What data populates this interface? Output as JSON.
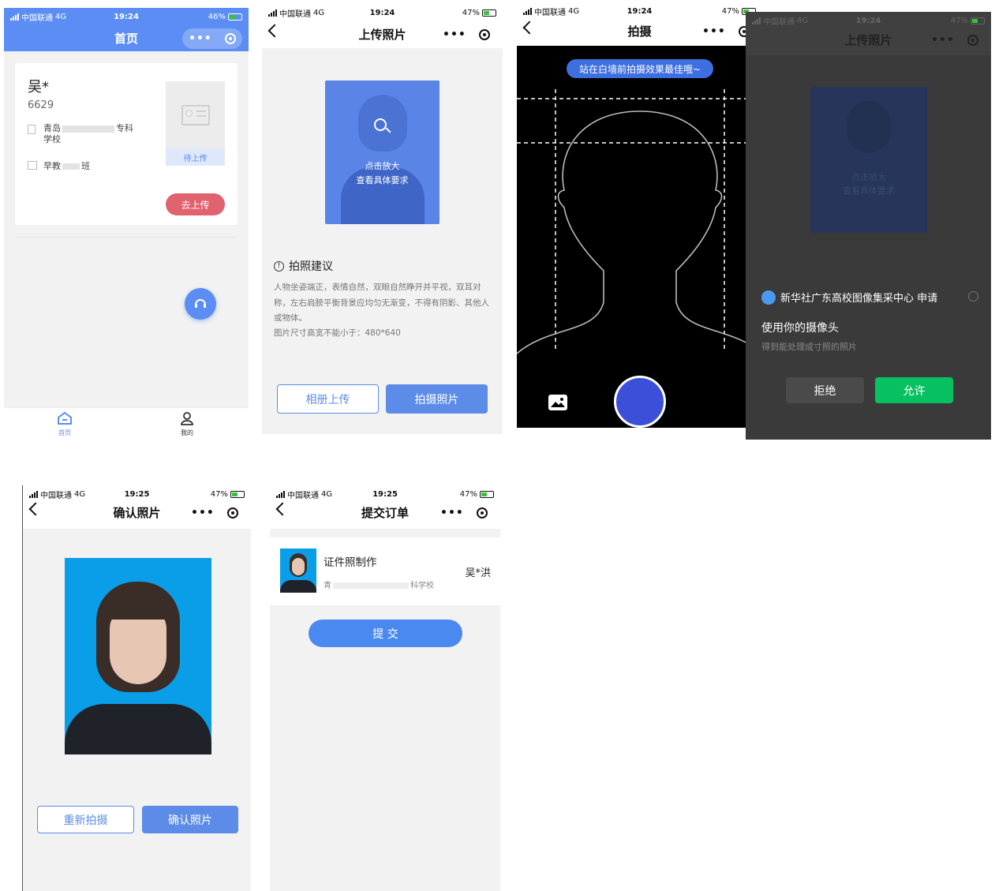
{
  "status": {
    "carrier": "中国联通",
    "network": "4G",
    "time1": "19:24",
    "time2": "19:25",
    "battery1": "46%",
    "battery2": "47%"
  },
  "home": {
    "title": "首页",
    "card": {
      "name": "吴*",
      "id": "6629",
      "school_start": "青岛",
      "school_mid": "专科",
      "school_end": "学校",
      "class_start": "早教",
      "class_end": "班",
      "photo_status": "待上传",
      "upload_button": "去上传"
    },
    "tabs": [
      {
        "label": "首页"
      },
      {
        "label": "我的"
      }
    ],
    "colors": {
      "accent": "#5b8df5",
      "danger": "#e26370"
    }
  },
  "upload": {
    "title": "上传照片",
    "preview_line1": "点击放大",
    "preview_line2": "查看具体要求",
    "tips_title": "拍照建议",
    "tips_body": "人物坐姿端正，表情自然，双眼自然睁开并平视，双耳对称，左右肩膀平衡背景应均匀无渐变，不得有阴影、其他人或物体。",
    "tips_size": "图片尺寸高宽不能小于：480*640",
    "album_button": "相册上传",
    "camera_button": "拍摄照片"
  },
  "camera": {
    "title": "拍摄",
    "hint": "站在白墙前拍摄效果最佳哦~",
    "shutter_color": "#3b4fd8"
  },
  "permission": {
    "title": "上传照片",
    "app_name": "新华社广东高校图像集采中心 申请",
    "request": "使用你的摄像头",
    "detail": "得到能处理成寸照的照片",
    "deny_button": "拒绝",
    "allow_button": "允许",
    "preview_line1": "点击放大",
    "preview_line2": "查看具体要求"
  },
  "confirm": {
    "title": "确认照片",
    "retake_button": "重新拍摄",
    "confirm_button": "确认照片"
  },
  "order": {
    "title": "提交订单",
    "item_title": "证件照制作",
    "item_school_start": "青",
    "item_school_end": "科学校",
    "item_name": "吴*洪",
    "submit_button": "提 交"
  }
}
